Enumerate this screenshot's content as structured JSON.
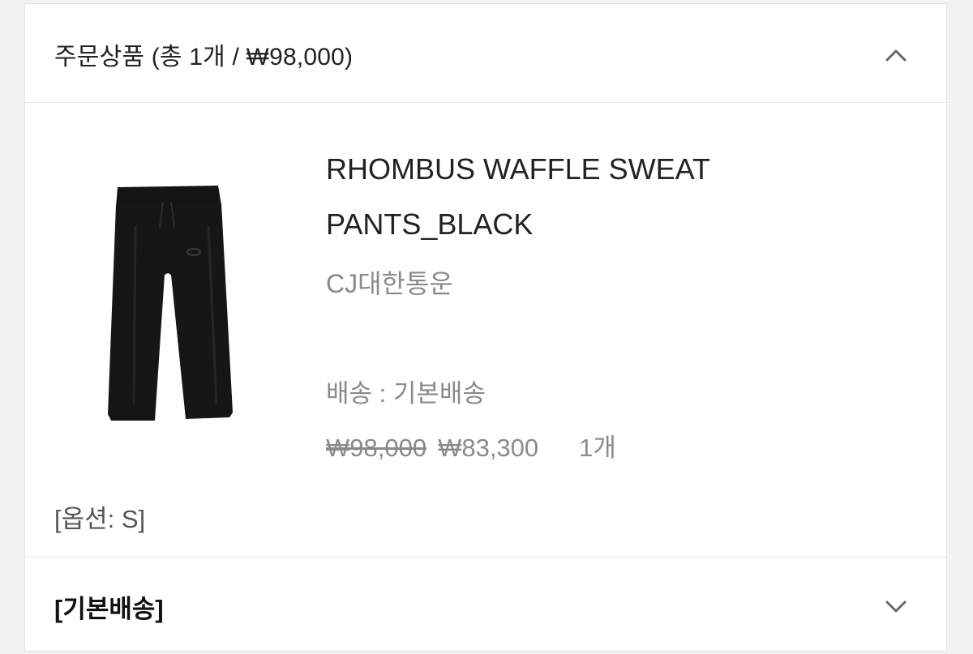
{
  "order_section": {
    "title": "주문상품 (총 1개 / ₩98,000)",
    "expanded": true
  },
  "product": {
    "name": "RHOMBUS WAFFLE SWEAT PANTS_BLACK",
    "courier": "CJ대한통운",
    "shipping": "배송 : 기본배송",
    "original_price": "₩98,000",
    "sale_price": "₩83,300",
    "quantity": "1개",
    "option": "[옵션: S]",
    "image_icon": "black-sweatpants-image"
  },
  "shipping_section": {
    "title": "[기본배송]",
    "expanded": false
  },
  "colors": {
    "text_primary": "#222222",
    "text_muted": "#8a8a8a",
    "border": "#e6e6e6",
    "background": "#f2f2f2"
  }
}
